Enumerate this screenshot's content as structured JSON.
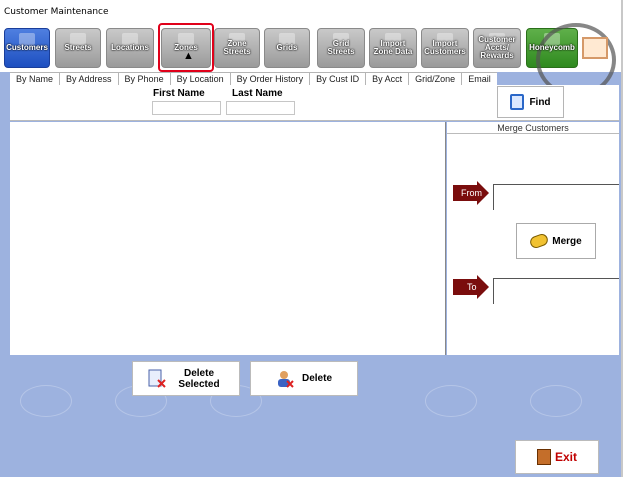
{
  "window": {
    "title": "Customer Maintenance"
  },
  "toolbar": {
    "buttons": [
      {
        "label": "Customers",
        "state": "active"
      },
      {
        "label": "Streets",
        "state": "normal"
      },
      {
        "label": "Locations",
        "state": "normal"
      },
      {
        "label": "Zones",
        "state": "normal"
      },
      {
        "label": "Zone Streets",
        "state": "normal"
      },
      {
        "label": "Grids",
        "state": "normal"
      },
      {
        "label": "Grid Streets",
        "state": "normal"
      },
      {
        "label": "Import Zone Data",
        "state": "normal"
      },
      {
        "label": "Import Customers",
        "state": "normal"
      },
      {
        "label": "Customer Accts/ Rewards",
        "state": "normal"
      },
      {
        "label": "Honeycomb",
        "state": "green"
      }
    ]
  },
  "tabs": [
    "By Name",
    "By Address",
    "By Phone",
    "By Location",
    "By Order History",
    "By Cust ID",
    "By Acct",
    "Grid/Zone",
    "Email"
  ],
  "search": {
    "first_name_label": "First Name",
    "last_name_label": "Last Name",
    "first_name_value": "",
    "last_name_value": "",
    "find_label": "Find"
  },
  "merge": {
    "title": "Merge Customers",
    "from_label": "From",
    "to_label": "To",
    "merge_label": "Merge"
  },
  "actions": {
    "delete_selected_label": "Delete Selected",
    "delete_label": "Delete",
    "exit_label": "Exit"
  },
  "colors": {
    "accent_blue": "#1d4fc0",
    "arrow_red": "#7a0d0d",
    "selection_red": "#e0001a",
    "background": "#9db2df"
  }
}
